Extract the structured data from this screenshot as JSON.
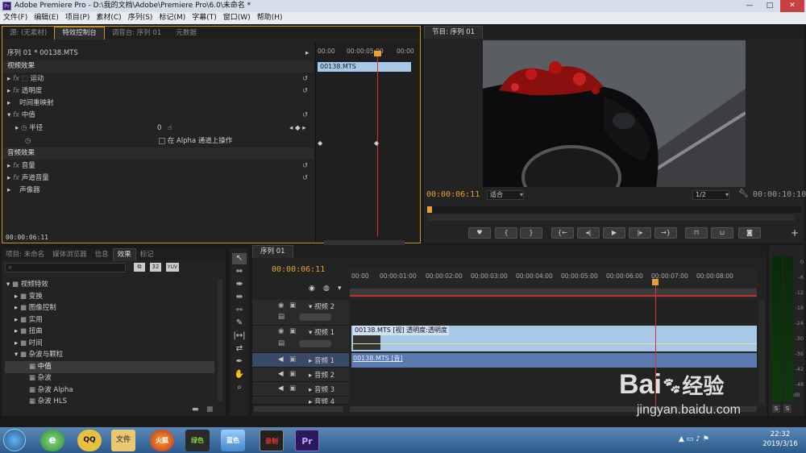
{
  "window": {
    "title": "Adobe Premiere Pro - D:\\我的文档\\Adobe\\Premiere Pro\\6.0\\未命名 *",
    "app_icon": "Pr",
    "min": "—",
    "max": "□",
    "close": "✕"
  },
  "menu": [
    "文件(F)",
    "编辑(E)",
    "项目(P)",
    "素材(C)",
    "序列(S)",
    "标记(M)",
    "字幕(T)",
    "窗口(W)",
    "帮助(H)"
  ],
  "source_panel": {
    "tabs": [
      "源: (无素材)",
      "特效控制台",
      "调音台: 序列 01",
      "元数据"
    ],
    "active_tab": 1,
    "header": "序列 01 * 00138.MTS",
    "clip_label": "00138.MTS",
    "timecodes": [
      "00:00",
      "00:00:05:00",
      "00:00"
    ],
    "video_effects_label": "视频效果",
    "audio_effects_label": "音频效果",
    "effects": [
      {
        "name": "运动",
        "fx": "fx"
      },
      {
        "name": "透明度",
        "fx": "fx"
      },
      {
        "name": "时间重映射",
        "fx": ""
      },
      {
        "name": "中值",
        "fx": "fx"
      }
    ],
    "param_name": "半径",
    "param_value": "0",
    "alpha_option": "在 Alpha 通道上操作",
    "audio_effects": [
      {
        "name": "音量",
        "fx": "fx"
      },
      {
        "name": "声道音量",
        "fx": "fx"
      },
      {
        "name": "声像器",
        "fx": ""
      }
    ],
    "current_time": "00:00:06:11"
  },
  "program_panel": {
    "title": "节目: 序列 01",
    "current_time": "00:00:06:11",
    "fit": "适合",
    "quality": "1/2",
    "duration": "00:00:10:10"
  },
  "project_panel": {
    "tabs": [
      "项目: 未命名",
      "媒体浏览器",
      "信息",
      "效果",
      "标记"
    ],
    "active_tab": 3,
    "badges": [
      "32",
      "YUV"
    ],
    "tree": [
      {
        "name": "视频特效",
        "level": 0,
        "open": true
      },
      {
        "name": "变换",
        "level": 1,
        "open": false
      },
      {
        "name": "图像控制",
        "level": 1,
        "open": false
      },
      {
        "name": "实用",
        "level": 1,
        "open": false
      },
      {
        "name": "扭曲",
        "level": 1,
        "open": false
      },
      {
        "name": "时间",
        "level": 1,
        "open": false
      },
      {
        "name": "杂波与颗粒",
        "level": 1,
        "open": true
      },
      {
        "name": "中值",
        "level": 2,
        "selected": true
      },
      {
        "name": "杂波",
        "level": 2
      },
      {
        "name": "杂波 Alpha",
        "level": 2
      },
      {
        "name": "杂波 HLS",
        "level": 2
      }
    ]
  },
  "timeline": {
    "tab": "序列 01",
    "current_time": "00:00:06:11",
    "ruler": [
      "00:00",
      "00:00:01:00",
      "00:00:02:00",
      "00:00:03:00",
      "00:00:04:00",
      "00:00:05:00",
      "00:00:06:00",
      "00:00:07:00",
      "00:00:08:00"
    ],
    "tracks": [
      {
        "name": "视频 2",
        "kind": "video"
      },
      {
        "name": "视频 1",
        "kind": "video"
      },
      {
        "name": "音频 1",
        "kind": "audio"
      },
      {
        "name": "音频 2",
        "kind": "audio"
      },
      {
        "name": "音频 3",
        "kind": "audio"
      },
      {
        "name": "音频 4",
        "kind": "audio"
      }
    ],
    "video_clip": "00138.MTS [视] 透明度:透明度",
    "audio_clip": "00138.MTS [音]"
  },
  "audio_meter": {
    "labels": [
      "0",
      "-6",
      "-12",
      "-18",
      "-24",
      "-30",
      "-36",
      "-42",
      "-48",
      "dB"
    ],
    "solo": [
      "S",
      "S"
    ]
  },
  "watermark": {
    "brand": "Bai",
    "brand2": "经验",
    "url": "jingyan.baidu.com"
  },
  "taskbar": {
    "time": "22:32",
    "date": "2019/3/16",
    "apps": [
      "e",
      "QQ",
      "文件",
      "火狐",
      "绿色",
      "蓝色",
      "录制",
      "Pr"
    ]
  },
  "colors": {
    "accent": "#e8a030",
    "playhead": "#e03030",
    "clip_video": "#a8c8e8",
    "clip_audio": "#5a7ab0"
  }
}
